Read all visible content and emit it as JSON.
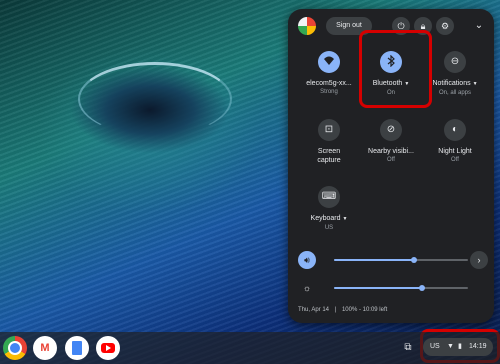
{
  "quick_settings": {
    "sign_out_label": "Sign out",
    "top_icons": [
      "power-icon",
      "lock-icon",
      "gear-icon",
      "chevron-down-icon"
    ],
    "tiles": [
      {
        "label": "elecom5g-xx...",
        "sub": "Strong",
        "icon": "wifi-icon",
        "active": true,
        "dropdown": false
      },
      {
        "label": "Bluetooth",
        "sub": "On",
        "icon": "bluetooth-icon",
        "active": true,
        "dropdown": true
      },
      {
        "label": "Notifications",
        "sub": "On, all apps",
        "icon": "notifications-icon",
        "active": false,
        "dropdown": true
      },
      {
        "label": "Screen",
        "label2": "capture",
        "icon": "screen-capture-icon",
        "active": false
      },
      {
        "label": "Nearby visibi...",
        "sub": "Off",
        "icon": "nearby-visibility-icon",
        "active": false
      },
      {
        "label": "Night Light",
        "sub": "Off",
        "icon": "night-light-icon",
        "active": false
      },
      {
        "label": "Keyboard",
        "sub": "US",
        "icon": "keyboard-icon",
        "active": false,
        "dropdown": true
      }
    ],
    "volume_level_percent": 60,
    "brightness_level_percent": 66,
    "date_text": "Thu, Apr 14",
    "battery_text": "100% - 10:09 left"
  },
  "shelf": {
    "apps": [
      "chrome-icon",
      "gmail-icon",
      "docs-icon",
      "youtube-icon"
    ],
    "gmail_glyph": "M",
    "ime": "US",
    "time": "14:19"
  },
  "colors": {
    "highlight": "#d50000",
    "accent": "#8ab4f8",
    "panel": "#202124"
  }
}
